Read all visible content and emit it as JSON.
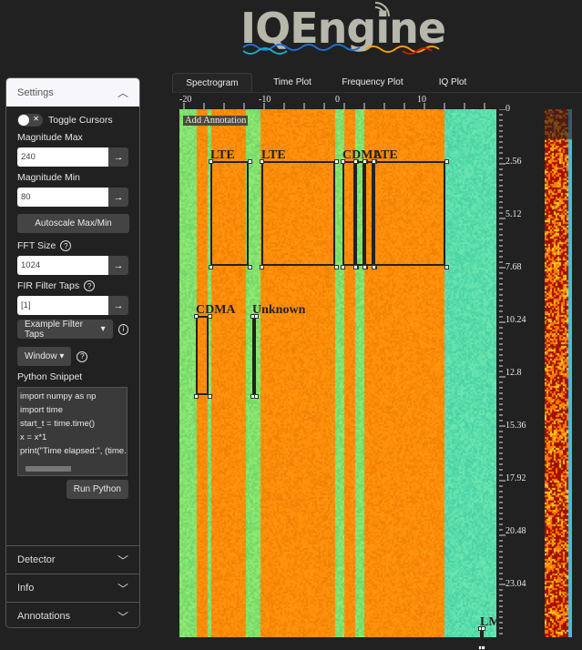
{
  "logo": {
    "text": "IQEngine"
  },
  "tabs": [
    "Spectrogram",
    "Time Plot",
    "Frequency Plot",
    "IQ Plot"
  ],
  "sidebar": {
    "settings_title": "Settings",
    "toggle_cursors": "Toggle Cursors",
    "magnitude_max_label": "Magnitude Max",
    "magnitude_max": "240",
    "magnitude_min_label": "Magnitude Min",
    "magnitude_min": "80",
    "autoscale": "Autoscale Max/Min",
    "fft_size_label": "FFT Size",
    "fft_size": "1024",
    "fir_label": "FIR Filter Taps",
    "fir": "[1]",
    "example_taps": "Example Filter Taps",
    "window": "Window",
    "python_label": "Python Snippet",
    "python_lines": [
      "import numpy as np",
      "import time",
      "start_t = time.time()",
      "x = x*1",
      "print(\"Time elapsed:\", (time.tim"
    ],
    "run_python": "Run Python",
    "sections": [
      "Detector",
      "Info",
      "Annotations"
    ]
  },
  "spectrogram": {
    "add_annotation": "Add Annotation",
    "x_ticks": [
      "-20",
      "-10",
      "0",
      "10"
    ],
    "y_ticks": [
      "0",
      "2.56",
      "5.12",
      "7.68",
      "10.24",
      "12.8",
      "15.36",
      "17.92",
      "20.48",
      "23.04"
    ],
    "annotations": [
      "LTE",
      "LTE",
      "CDMA",
      "LTE",
      "CDMA",
      "Unknown",
      "LM"
    ],
    "colors": {
      "green": "#7fe07a",
      "orange": "#ff8a00",
      "cyan": "#54e0b8",
      "red": "#b01000"
    }
  }
}
